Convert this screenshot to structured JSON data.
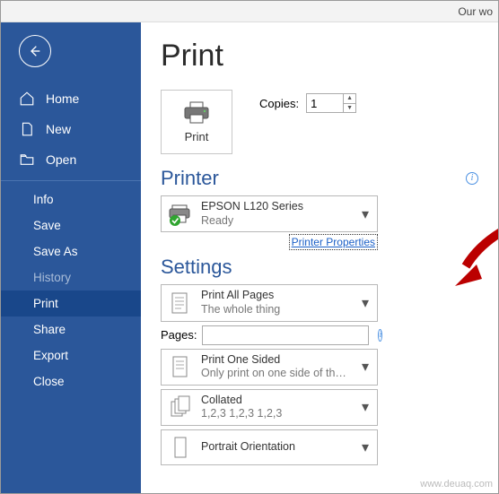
{
  "titlebar": {
    "text": "Our wo"
  },
  "sidebar": {
    "home": "Home",
    "new": "New",
    "open": "Open",
    "info": "Info",
    "save": "Save",
    "saveas": "Save As",
    "history": "History",
    "print": "Print",
    "share": "Share",
    "export": "Export",
    "close": "Close"
  },
  "page": {
    "title": "Print",
    "print_button": "Print",
    "copies_label": "Copies:",
    "copies_value": "1"
  },
  "printer": {
    "heading": "Printer",
    "name": "EPSON L120 Series",
    "status": "Ready",
    "properties_link": "Printer Properties"
  },
  "settings": {
    "heading": "Settings",
    "print_all": {
      "title": "Print All Pages",
      "sub": "The whole thing"
    },
    "pages_label": "Pages:",
    "pages_value": "",
    "one_sided": {
      "title": "Print One Sided",
      "sub": "Only print on one side of th…"
    },
    "collated": {
      "title": "Collated",
      "sub": "1,2,3   1,2,3   1,2,3"
    },
    "orientation": {
      "title": "Portrait Orientation"
    }
  },
  "watermark": "www.deuaq.com"
}
